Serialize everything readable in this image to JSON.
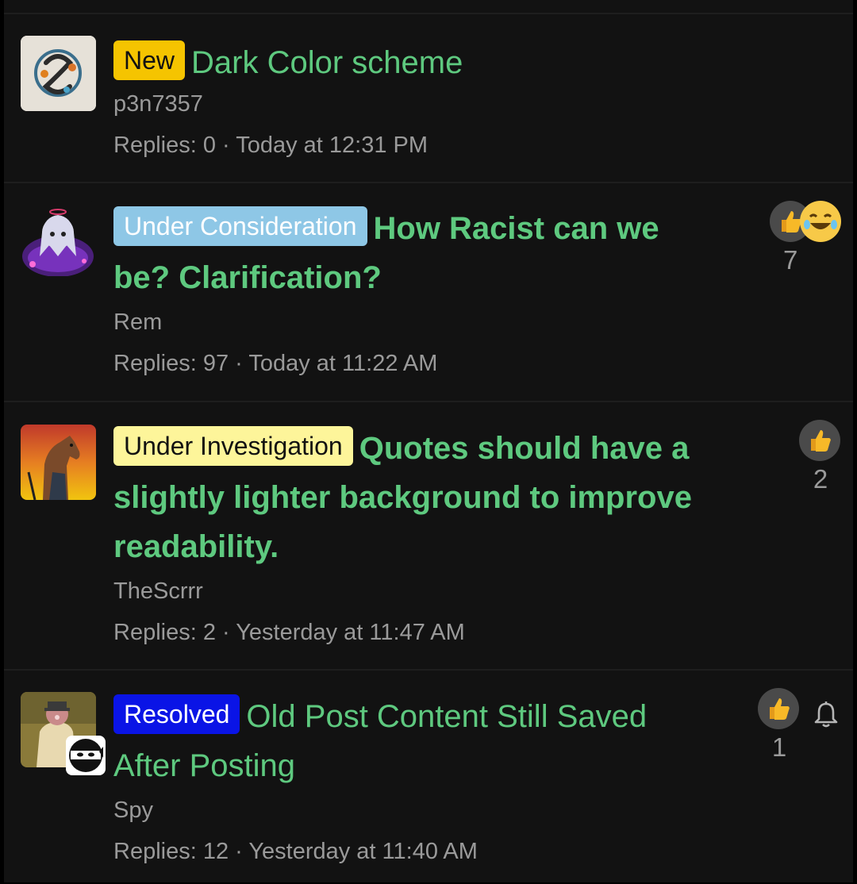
{
  "threads": [
    {
      "label": "New",
      "label_bg": "#f5c400",
      "label_color": "#111111",
      "title": "Dark Color scheme",
      "author": "p3n7357",
      "replies_label": "Replies: 0",
      "separator": " · ",
      "time": "Today at 12:31 PM"
    },
    {
      "label": "Under Consideration",
      "label_bg": "#8ec7e6",
      "label_color": "#ffffff",
      "title_line1": "How Racist can we",
      "title_line2": "be? Clarification?",
      "author": "Rem",
      "replies_label": "Replies: 97",
      "separator": " · ",
      "time": "Today at 11:22 AM",
      "reaction_count": "7",
      "reactions": [
        "thumbs-up-icon",
        "laughing-face-icon"
      ]
    },
    {
      "label": "Under Investigation",
      "label_bg": "#fdf59a",
      "label_color": "#111111",
      "title_line1": "Quotes should have a",
      "title_line2": "slightly lighter background to improve",
      "title_line3": "readability.",
      "author": "TheScrrr",
      "replies_label": "Replies: 2",
      "separator": " · ",
      "time": "Yesterday at 11:47 AM",
      "reaction_count": "2",
      "reactions": [
        "thumbs-up-icon"
      ]
    },
    {
      "label": "Resolved",
      "label_bg": "#0a14e6",
      "label_color": "#ffffff",
      "title_line1": "Old Post Content Still Saved",
      "title_line2": "After Posting",
      "author": "Spy",
      "replies_label": "Replies: 12",
      "separator": " · ",
      "time": "Yesterday at 11:40 AM",
      "reaction_count": "1",
      "reactions": [
        "thumbs-up-icon"
      ],
      "watch_icon": "bell-icon"
    }
  ],
  "colors": {
    "title": "#5ec97f",
    "meta": "#9a9a9a",
    "background": "#121212"
  }
}
